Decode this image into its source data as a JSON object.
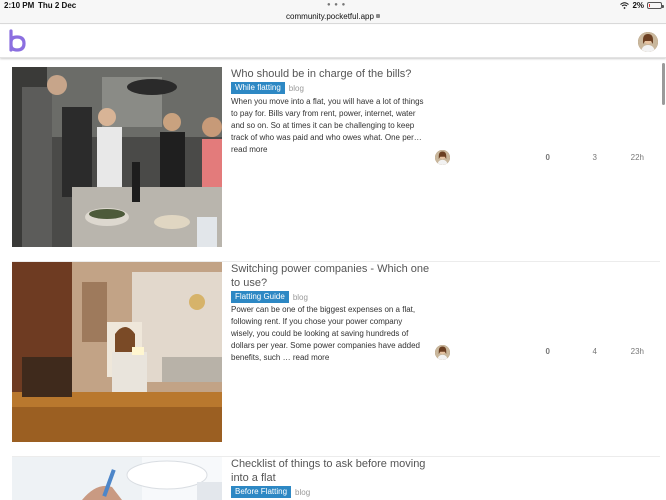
{
  "status_bar": {
    "time": "2:10 PM",
    "date": "Thu 2 Dec",
    "battery": "2%"
  },
  "browser": {
    "url": "community.pocketful.app"
  },
  "topics": [
    {
      "title": "Who should be in charge of the bills?",
      "category": "While flatting",
      "tag": "blog",
      "excerpt": "When you move into a flat, you will have a lot of things to pay for. Bills vary from rent, power, internet, water and so on. So at times it can be challenging to keep track of who was paid and who owes what. One per…",
      "read_more": "read more",
      "likes": "0",
      "replies": "3",
      "activity": "22h"
    },
    {
      "title": "Switching power companies - Which one to use?",
      "category": "Flatting Guide",
      "tag": "blog",
      "excerpt": "Power can be one of the biggest expenses on a flat, following rent. If you chose your power company wisely, you could be looking at saving hundreds of dollars per year. Some power companies have added benefits, such …",
      "read_more": "read more",
      "likes": "0",
      "replies": "4",
      "activity": "23h"
    },
    {
      "title": "Checklist of things to ask before moving into a flat",
      "category": "Before Flatting",
      "tag": "blog"
    }
  ],
  "colors": {
    "category_bg": "#2d88c4",
    "logo": "#8b6fe0"
  }
}
